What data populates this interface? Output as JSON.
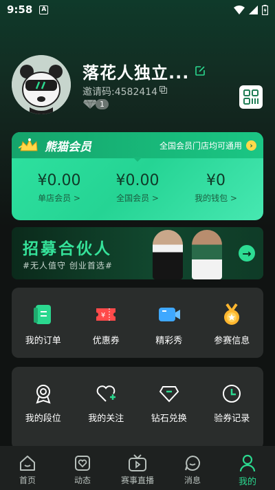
{
  "status_bar": {
    "time": "9:58",
    "notification": "A"
  },
  "profile": {
    "username": "落花人独立...",
    "invite_code": "邀请码:4582414",
    "badge_count": "1"
  },
  "vip": {
    "title": "熊猫会员",
    "note": "全国会员门店均可通用",
    "cols": [
      {
        "amount": "¥0.00",
        "label": "单店会员 >"
      },
      {
        "amount": "¥0.00",
        "label": "全国会员 >"
      },
      {
        "amount": "¥0",
        "label": "我的钱包 >"
      }
    ]
  },
  "banner": {
    "title": "招募合伙人",
    "subtitle": "#无人值守 创业首选#"
  },
  "grid1": [
    {
      "label": "我的订单",
      "icon": "order-icon"
    },
    {
      "label": "优惠券",
      "icon": "coupon-icon"
    },
    {
      "label": "精彩秀",
      "icon": "video-icon"
    },
    {
      "label": "参赛信息",
      "icon": "medal-icon"
    }
  ],
  "grid2": [
    {
      "label": "我的段位",
      "icon": "rank-icon"
    },
    {
      "label": "我的关注",
      "icon": "follow-icon"
    },
    {
      "label": "钻石兑换",
      "icon": "diamond-icon"
    },
    {
      "label": "验券记录",
      "icon": "clock-icon"
    }
  ],
  "nav": [
    {
      "label": "首页",
      "icon": "home-icon"
    },
    {
      "label": "动态",
      "icon": "feed-icon"
    },
    {
      "label": "赛事直播",
      "icon": "tv-icon"
    },
    {
      "label": "消息",
      "icon": "message-icon"
    },
    {
      "label": "我的",
      "icon": "profile-icon",
      "active": true
    }
  ],
  "colors": {
    "accent": "#2bd88f",
    "card": "#2a2d2c",
    "background": "#101312"
  }
}
